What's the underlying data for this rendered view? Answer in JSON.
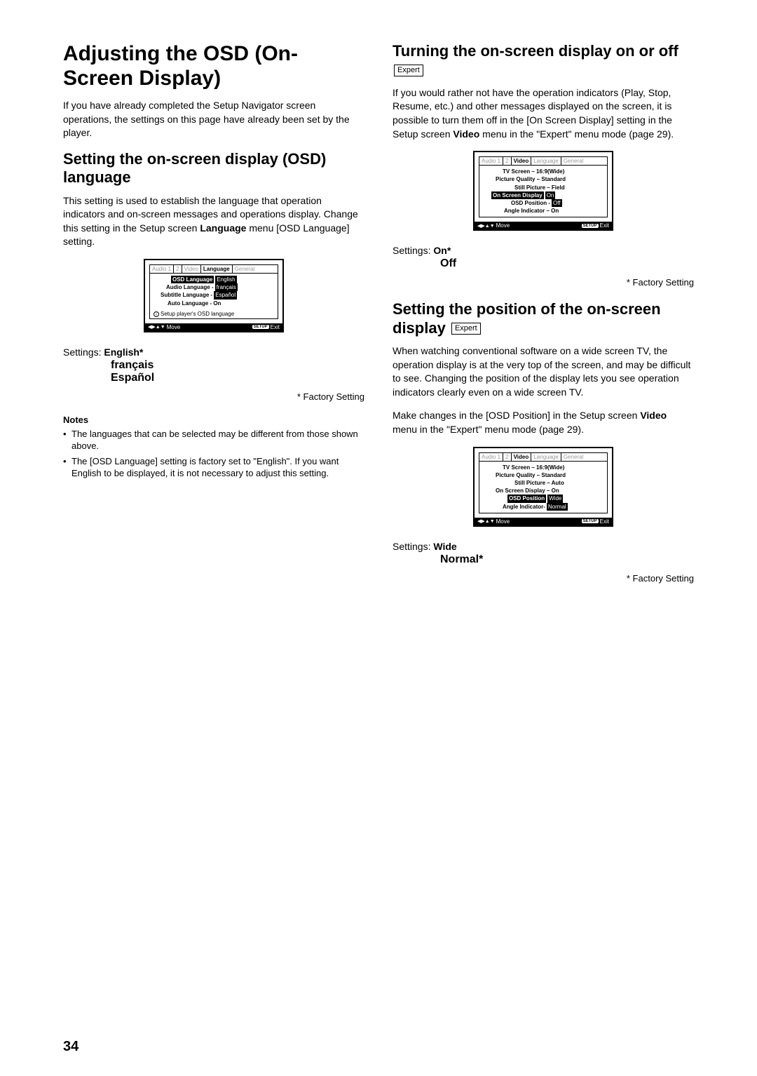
{
  "left": {
    "h1": "Adjusting the OSD (On-Screen Display)",
    "intro": "If you have already completed the Setup Navigator screen operations, the settings on this page have already been set by the player.",
    "section1": {
      "heading": "Setting the on-screen display (OSD) language",
      "body_pre": "This setting is used to establish the language that operation indicators and on-screen messages and operations display. Change this setting in the Setup screen ",
      "body_bold": "Language",
      "body_post": " menu [OSD Language] setting.",
      "screenshot": {
        "tabs": [
          "Audio 1",
          "2",
          "Video",
          "Language",
          "General"
        ],
        "active_tab": "Language",
        "rows": [
          {
            "label": "OSD Language",
            "value": "English",
            "label_hl": true,
            "value_hl": true
          },
          {
            "label": "Audio Language - ",
            "value": "français",
            "value_hl": true
          },
          {
            "label": "Subtitle Language - ",
            "value": "Español",
            "value_hl": true
          },
          {
            "label": "Auto Language - On",
            "value": ""
          }
        ],
        "tip": "Setup player's OSD language",
        "footer_move": "Move",
        "footer_exit": "Exit",
        "footer_setup": "SETUP"
      },
      "settings_label": "Settings:",
      "settings_options": [
        "English*",
        "français",
        "Español"
      ],
      "factory": "* Factory Setting",
      "notes_heading": "Notes",
      "notes": [
        "The languages that can be selected may be different from those shown above.",
        "The [OSD Language] setting is factory set to \"English\". If you want English to be displayed, it is not necessary to adjust this setting."
      ]
    }
  },
  "right": {
    "section1": {
      "heading": "Turning the on-screen display on or off",
      "expert": "Expert",
      "body_pre": "If you would rather not have the operation indicators (Play, Stop, Resume, etc.) and other messages displayed on the screen, it is possible to turn them off in the [On Screen Display] setting in the Setup screen ",
      "body_bold": "Video",
      "body_post": " menu in the \"Expert\" menu mode (page 29).",
      "screenshot": {
        "tabs": [
          "Audio 1",
          "2",
          "Video",
          "Language",
          "General"
        ],
        "active_tab": "Video",
        "rows": [
          {
            "label": "TV Screen – 16:9(Wide)",
            "value": ""
          },
          {
            "label": "Picture Quality – Standard",
            "value": ""
          },
          {
            "label": "Still Picture – Field",
            "value": ""
          },
          {
            "label": "On Screen Display",
            "value": "On",
            "label_hl": true,
            "value_hl": true
          },
          {
            "label": "OSD Position - ",
            "value": "Off",
            "value_hl": true
          },
          {
            "label": "Angle Indicator – On",
            "value": ""
          }
        ],
        "footer_move": "Move",
        "footer_exit": "Exit",
        "footer_setup": "SETUP"
      },
      "settings_label": "Settings:",
      "settings_options": [
        "On*",
        "Off"
      ],
      "factory": "* Factory Setting"
    },
    "section2": {
      "heading": "Setting the position of the on-screen display",
      "expert": "Expert",
      "body": "When watching conventional software on a wide screen TV, the operation display is at the very top of the screen, and may be difficult to see. Changing the position of the display lets you see operation indicators clearly even on a wide screen TV.",
      "body2_pre": "Make changes in the [OSD Position] in the Setup screen ",
      "body2_bold": "Video",
      "body2_post": " menu in the \"Expert\" menu mode (page 29).",
      "screenshot": {
        "tabs": [
          "Audio 1",
          "2",
          "Video",
          "Language",
          "General"
        ],
        "active_tab": "Video",
        "rows": [
          {
            "label": "TV Screen – 16:9(Wide)",
            "value": ""
          },
          {
            "label": "Picture Quality – Standard",
            "value": ""
          },
          {
            "label": "Still Picture – Auto",
            "value": ""
          },
          {
            "label": "On Screen Display – On",
            "value": ""
          },
          {
            "label": "OSD Position",
            "value": "Wide",
            "label_hl": true,
            "value_hl": true
          },
          {
            "label": "Angle Indicator- ",
            "value": "Normal",
            "value_hl": true
          }
        ],
        "footer_move": "Move",
        "footer_exit": "Exit",
        "footer_setup": "SETUP"
      },
      "settings_label": "Settings:",
      "settings_options": [
        "Wide",
        "Normal*"
      ],
      "factory": "* Factory Setting"
    }
  },
  "page_number": "34"
}
